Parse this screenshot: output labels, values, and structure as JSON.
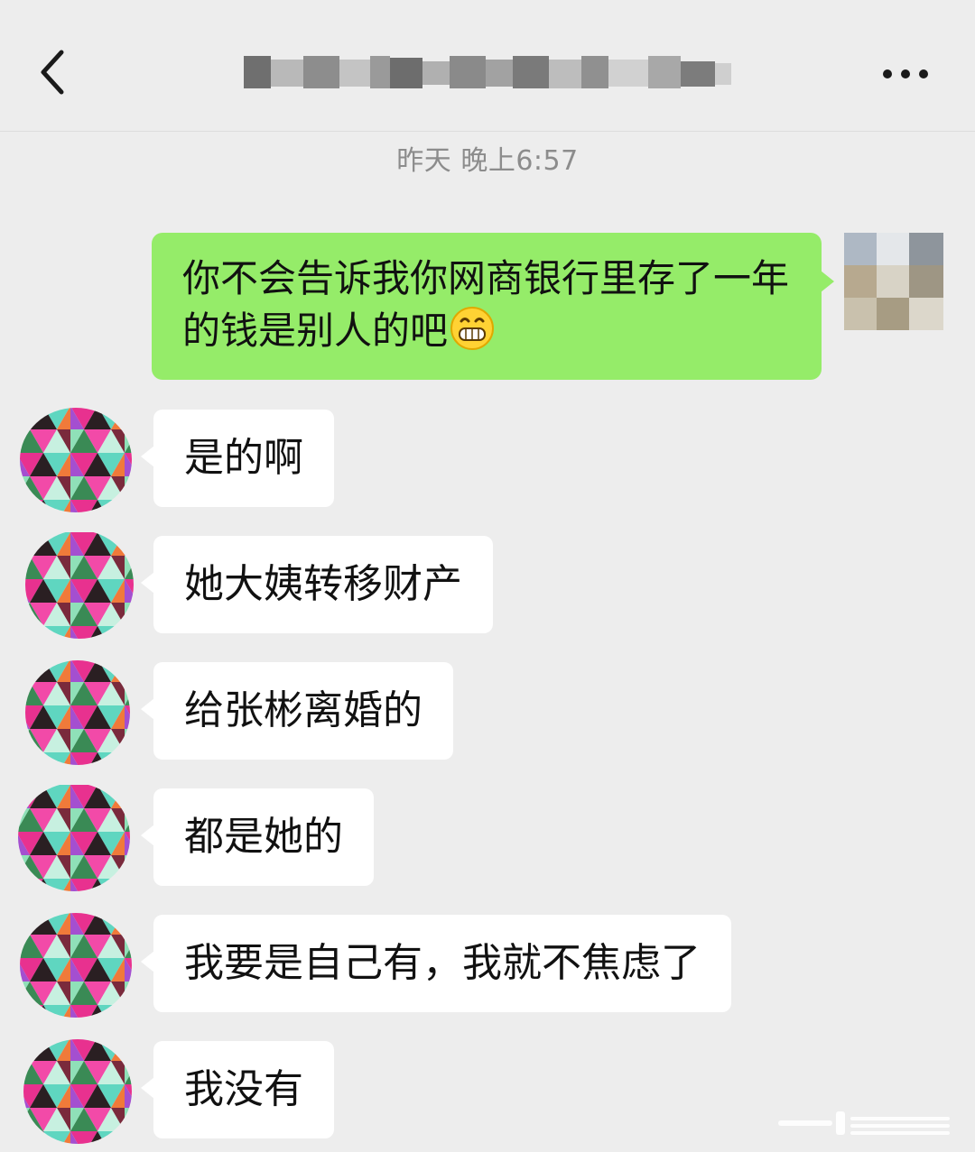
{
  "header": {
    "back_icon": "chevron-left-icon",
    "title": "",
    "more_icon": "more-horizontal-icon"
  },
  "chat": {
    "timestamp": "昨天 晚上6:57",
    "outgoing": [
      {
        "text": "你不会告诉我你网商银行里存了一年的钱是别人的吧",
        "emoji": "grinning-face-icon"
      }
    ],
    "incoming": [
      {
        "text": "是的啊"
      },
      {
        "text": "她大姨转移财产"
      },
      {
        "text": "给张彬离婚的"
      },
      {
        "text": "都是她的"
      },
      {
        "text": "我要是自己有，我就不焦虑了"
      },
      {
        "text": "我没有"
      }
    ]
  },
  "colors": {
    "background": "#ededed",
    "outgoing_bubble": "#95ec69",
    "incoming_bubble": "#ffffff",
    "timestamp_text": "#8c8c8c"
  }
}
